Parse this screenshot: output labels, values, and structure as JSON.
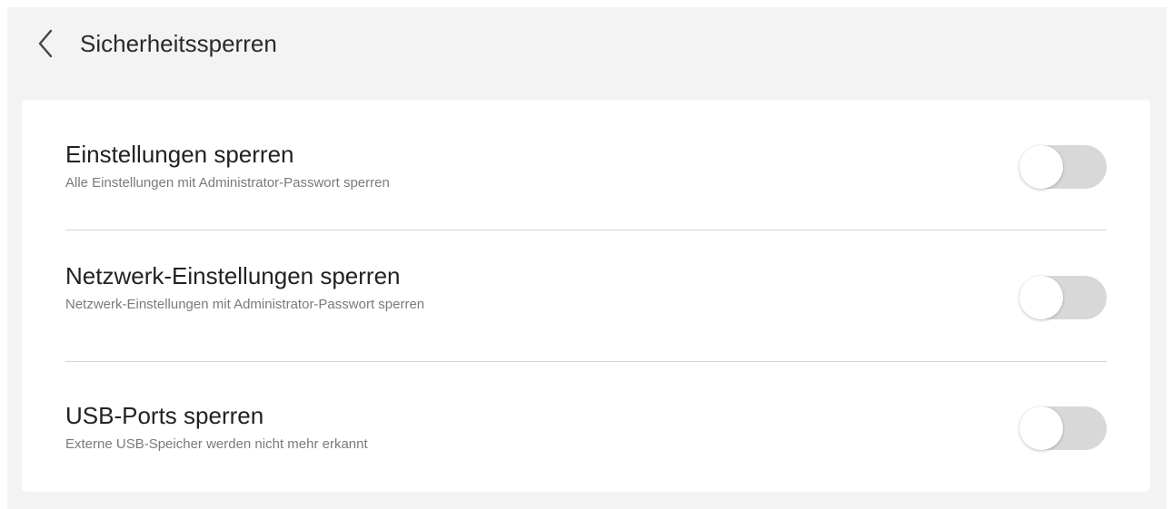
{
  "header": {
    "back_icon": "chevron-left-icon",
    "title": "Sicherheitssperren"
  },
  "settings": [
    {
      "title": "Einstellungen sperren",
      "subtitle": "Alle Einstellungen mit Administrator-Passwort sperren",
      "enabled": false
    },
    {
      "title": "Netzwerk-Einstellungen sperren",
      "subtitle": "Netzwerk-Einstellungen mit Administrator-Passwort sperren",
      "enabled": false
    },
    {
      "title": "USB-Ports sperren",
      "subtitle": "Externe USB-Speicher werden nicht mehr erkannt",
      "enabled": false
    }
  ],
  "colors": {
    "background": "#f3f3f3",
    "card": "#ffffff",
    "toggle_off": "#d8d8d8"
  }
}
